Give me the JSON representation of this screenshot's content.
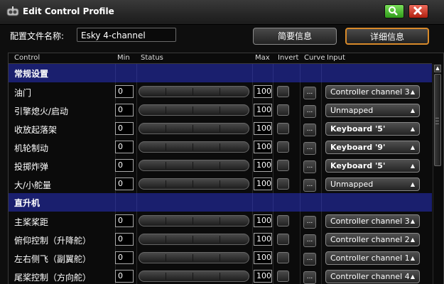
{
  "window": {
    "title": "Edit Control Profile"
  },
  "titlebar_buttons": {
    "search_icon": "magnifier-icon",
    "close_icon": "close-x-icon"
  },
  "profile": {
    "label": "配置文件名称:",
    "name": "Esky 4-channel"
  },
  "tabs": {
    "simple": "简要信息",
    "detail": "详细信息"
  },
  "columns": {
    "control": "Control",
    "min": "Min",
    "status": "Status",
    "max": "Max",
    "invert": "Invert",
    "curve": "Curve",
    "input": "Input"
  },
  "curve_button_label": "...",
  "dropdown_arrow": "▲",
  "scroll_up_arrow": "▲",
  "sections": [
    {
      "label": "常规设置",
      "rows": [
        {
          "label": "油门",
          "min": "0",
          "max": "100",
          "input": "Controller channel 3",
          "input_bold": false
        },
        {
          "label": "引擎熄火/启动",
          "min": "0",
          "max": "100",
          "input": "Unmapped",
          "input_bold": false
        },
        {
          "label": "收放起落架",
          "min": "0",
          "max": "100",
          "input": "Keyboard '5'",
          "input_bold": true
        },
        {
          "label": "机轮制动",
          "min": "0",
          "max": "100",
          "input": "Keyboard '9'",
          "input_bold": true
        },
        {
          "label": "投掷炸弹",
          "min": "0",
          "max": "100",
          "input": "Keyboard '5'",
          "input_bold": true
        },
        {
          "label": "大/小舵量",
          "min": "0",
          "max": "100",
          "input": "Unmapped",
          "input_bold": false
        }
      ]
    },
    {
      "label": "直升机",
      "rows": [
        {
          "label": "主桨桨距",
          "min": "0",
          "max": "100",
          "input": "Controller channel 3",
          "input_bold": false
        },
        {
          "label": "俯仰控制（升降舵）",
          "min": "0",
          "max": "100",
          "input": "Controller channel 2",
          "input_bold": false
        },
        {
          "label": "左右侧飞（副翼舵）",
          "min": "0",
          "max": "100",
          "input": "Controller channel 1",
          "input_bold": false
        },
        {
          "label": "尾桨控制（方向舵）",
          "min": "0",
          "max": "100",
          "input": "Controller channel 4",
          "input_bold": false
        }
      ]
    }
  ]
}
